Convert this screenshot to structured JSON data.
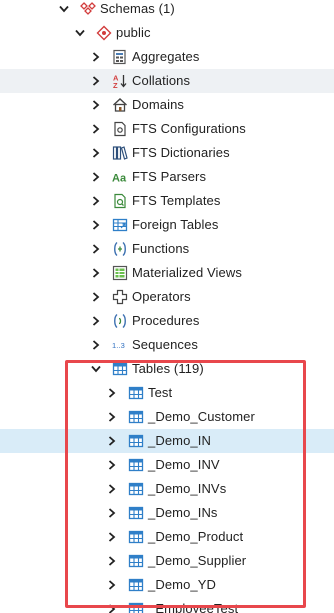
{
  "tree": {
    "schemas": {
      "label": "Schemas (1)",
      "icon": "schemas-icon",
      "expanded": true
    },
    "public": {
      "label": "public",
      "icon": "schema-icon",
      "expanded": true
    },
    "nodes": [
      {
        "label": "Aggregates",
        "icon": "aggregates-icon"
      },
      {
        "label": "Collations",
        "icon": "collations-icon"
      },
      {
        "label": "Domains",
        "icon": "domains-icon"
      },
      {
        "label": "FTS Configurations",
        "icon": "fts-configurations-icon"
      },
      {
        "label": "FTS Dictionaries",
        "icon": "fts-dictionaries-icon"
      },
      {
        "label": "FTS Parsers",
        "icon": "fts-parsers-icon"
      },
      {
        "label": "FTS Templates",
        "icon": "fts-templates-icon"
      },
      {
        "label": "Foreign Tables",
        "icon": "foreign-tables-icon"
      },
      {
        "label": "Functions",
        "icon": "functions-icon"
      },
      {
        "label": "Materialized Views",
        "icon": "materialized-views-icon"
      },
      {
        "label": "Operators",
        "icon": "operators-icon"
      },
      {
        "label": "Procedures",
        "icon": "procedures-icon"
      },
      {
        "label": "Sequences",
        "icon": "sequences-icon"
      }
    ],
    "tables": {
      "label": "Tables (119)",
      "icon": "table-icon",
      "expanded": true
    },
    "table_items": [
      {
        "label": "Test"
      },
      {
        "label": "_Demo_Customer"
      },
      {
        "label": "_Demo_IN",
        "selected": true
      },
      {
        "label": "_Demo_INV"
      },
      {
        "label": "_Demo_INVs"
      },
      {
        "label": "_Demo_INs"
      },
      {
        "label": "_Demo_Product"
      },
      {
        "label": "_Demo_Supplier"
      },
      {
        "label": "_Demo_YD"
      },
      {
        "label": "_EmployeeTest"
      }
    ],
    "highlight_color": "#e8474c",
    "selection_color": "#d9ecf8",
    "hover_color": "#eef1f4"
  }
}
